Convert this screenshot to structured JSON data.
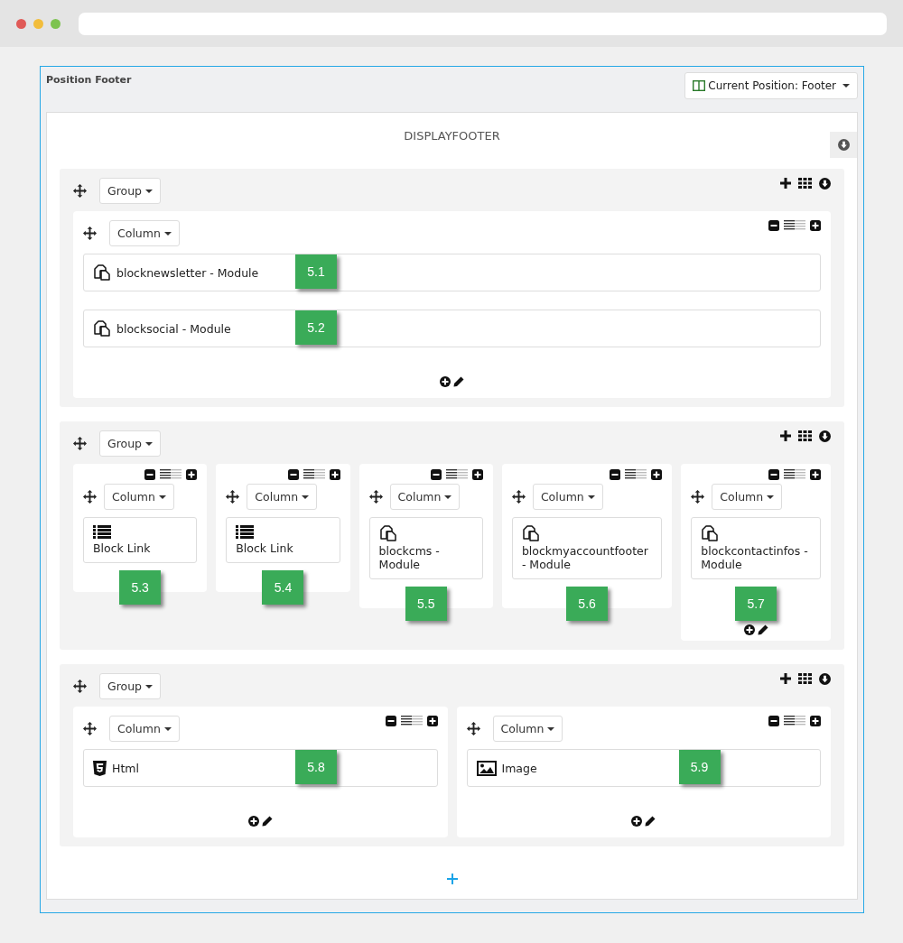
{
  "panel": {
    "title": "Position Footer",
    "position_button": "Current Position: Footer"
  },
  "hook": {
    "title": "DISPLAYFOOTER"
  },
  "groups": [
    {
      "kind": "rows",
      "label": "Group",
      "columns": [
        {
          "label": "Column",
          "footer_tools": true,
          "modules": [
            {
              "kind": "module",
              "label": "blocknewsletter - Module",
              "badge": "5.1"
            },
            {
              "kind": "module",
              "label": "blocksocial - Module",
              "badge": "5.2"
            }
          ]
        }
      ]
    },
    {
      "kind": "tiles",
      "label": "Group",
      "columns": [
        {
          "label": "Column",
          "footer_tools": false,
          "modules": [
            {
              "kind": "list",
              "label": "Block Link",
              "badge": "5.3"
            }
          ]
        },
        {
          "label": "Column",
          "footer_tools": false,
          "modules": [
            {
              "kind": "list",
              "label": "Block Link",
              "badge": "5.4"
            }
          ]
        },
        {
          "label": "Column",
          "footer_tools": false,
          "modules": [
            {
              "kind": "module",
              "label": "blockcms - Module",
              "badge": "5.5"
            }
          ]
        },
        {
          "label": "Column",
          "footer_tools": false,
          "modules": [
            {
              "kind": "module",
              "label": "blockmyaccountfooter - Module",
              "badge": "5.6"
            }
          ]
        },
        {
          "label": "Column",
          "footer_tools": true,
          "modules": [
            {
              "kind": "module",
              "label": "blockcontactinfos - Module",
              "badge": "5.7"
            }
          ]
        }
      ]
    },
    {
      "kind": "rows",
      "label": "Group",
      "columns": [
        {
          "label": "Column",
          "footer_tools": true,
          "modules": [
            {
              "kind": "html5",
              "label": "Html",
              "badge": "5.8"
            }
          ]
        },
        {
          "label": "Column",
          "footer_tools": true,
          "modules": [
            {
              "kind": "image",
              "label": "Image",
              "badge": "5.9"
            }
          ]
        }
      ]
    }
  ]
}
